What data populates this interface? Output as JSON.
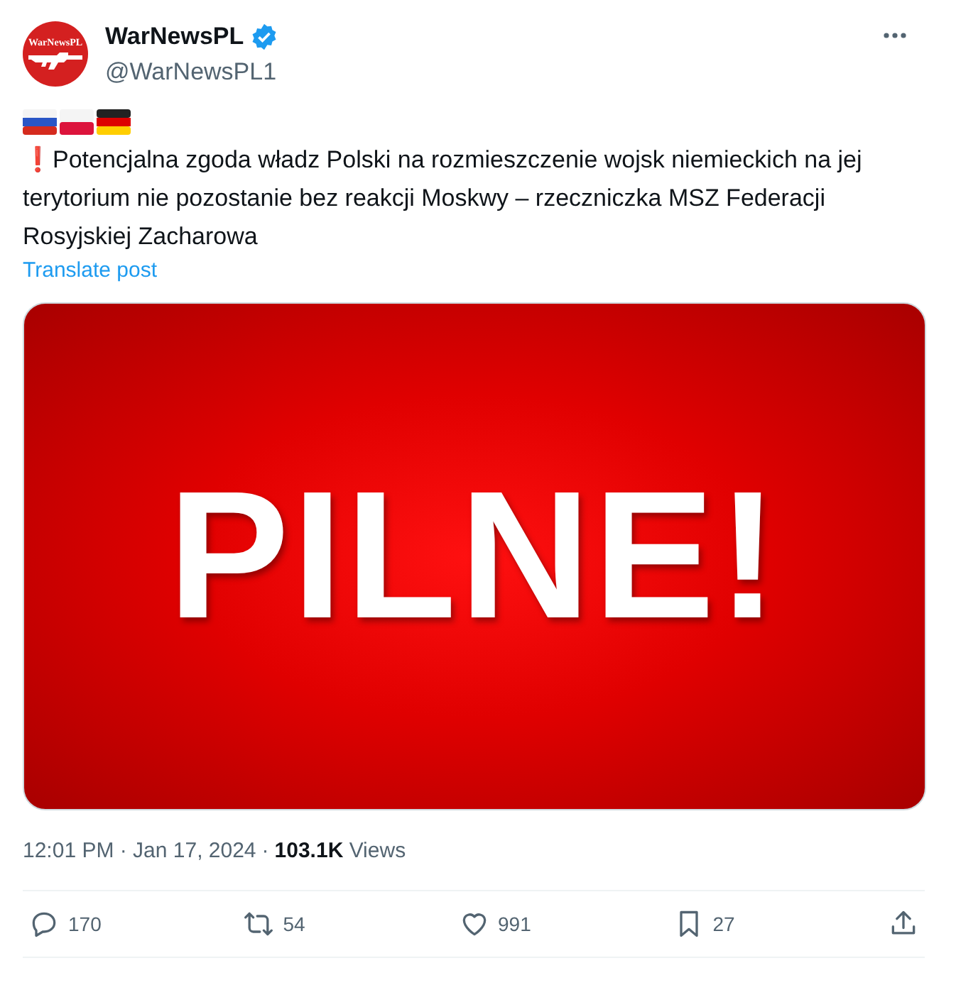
{
  "author": {
    "avatar_text": "WarNewsPL",
    "name": "WarNewsPL",
    "verified": true,
    "handle": "@WarNewsPL1"
  },
  "flags": [
    {
      "kind": "ru"
    },
    {
      "kind": "pl"
    },
    {
      "kind": "de"
    }
  ],
  "post": {
    "marker": "❗",
    "text": "Potencjalna zgoda władz Polski na rozmieszczenie wojsk niemieckich na jej terytorium nie pozostanie bez reakcji Moskwy – rzeczniczka MSZ Federacji Rosyjskiej Zacharowa",
    "translate": "Translate post"
  },
  "media": {
    "text": "PILNE!"
  },
  "meta": {
    "time": "12:01 PM",
    "separator": "·",
    "date": "Jan 17, 2024",
    "views_count": "103.1K",
    "views_label": "Views"
  },
  "actions": [
    {
      "kind": "reply",
      "count": "170"
    },
    {
      "kind": "repost",
      "count": "54"
    },
    {
      "kind": "like",
      "count": "991"
    },
    {
      "kind": "bookmark",
      "count": "27"
    },
    {
      "kind": "share"
    }
  ]
}
